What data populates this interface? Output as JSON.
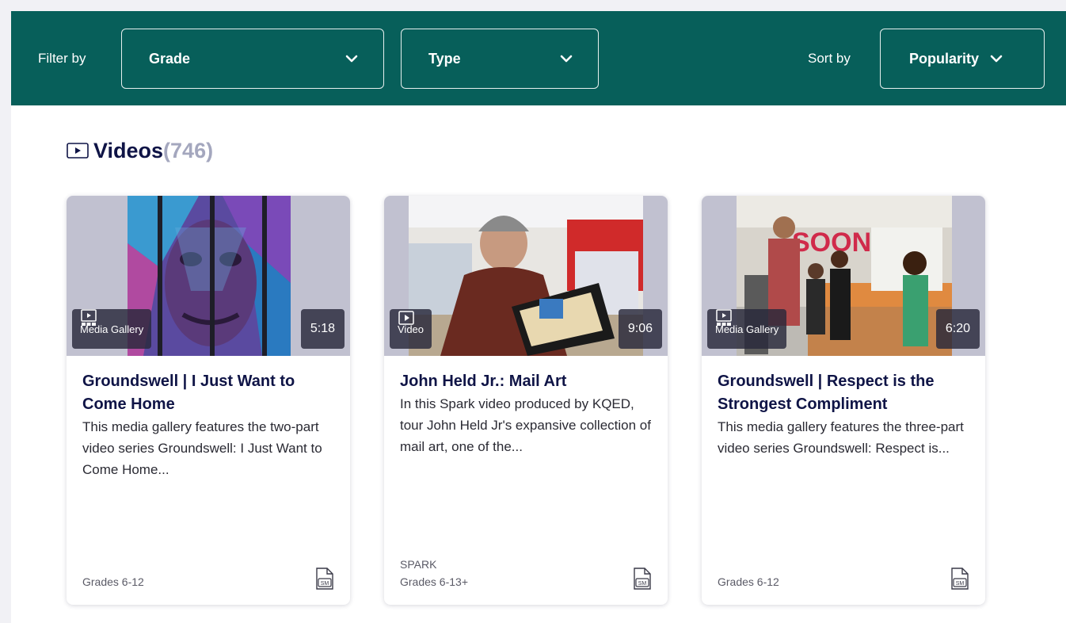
{
  "filter_bar": {
    "filter_label": "Filter by",
    "grade_label": "Grade",
    "type_label": "Type",
    "sort_label": "Sort by",
    "sort_value": "Popularity"
  },
  "section": {
    "title": "Videos",
    "count": "(746)"
  },
  "cards": [
    {
      "type_label": "Media Gallery",
      "type_icon": "media-gallery-icon",
      "duration": "5:18",
      "title": "Groundswell | I Just Want to Come Home",
      "description": "This media gallery features the two-part video series Groundswell: I Just Want to Come Home...",
      "source": "",
      "grades": "Grades 6-12"
    },
    {
      "type_label": "Video",
      "type_icon": "video-icon",
      "duration": "9:06",
      "title": "John Held Jr.: Mail Art",
      "description": "In this Spark video produced by KQED, tour John Held Jr's expansive collection of mail art, one of the...",
      "source": "SPARK",
      "grades": "Grades 6-13+"
    },
    {
      "type_label": "Media Gallery",
      "type_icon": "media-gallery-icon",
      "duration": "6:20",
      "title": "Groundswell | Respect is the Strongest Compliment",
      "description": "This media gallery features the three-part video series Groundswell: Respect is...",
      "source": "",
      "grades": "Grades 6-12"
    }
  ],
  "colors": {
    "filter_bar": "#075f5a",
    "title": "#0f1446",
    "count": "#a4a7be"
  }
}
